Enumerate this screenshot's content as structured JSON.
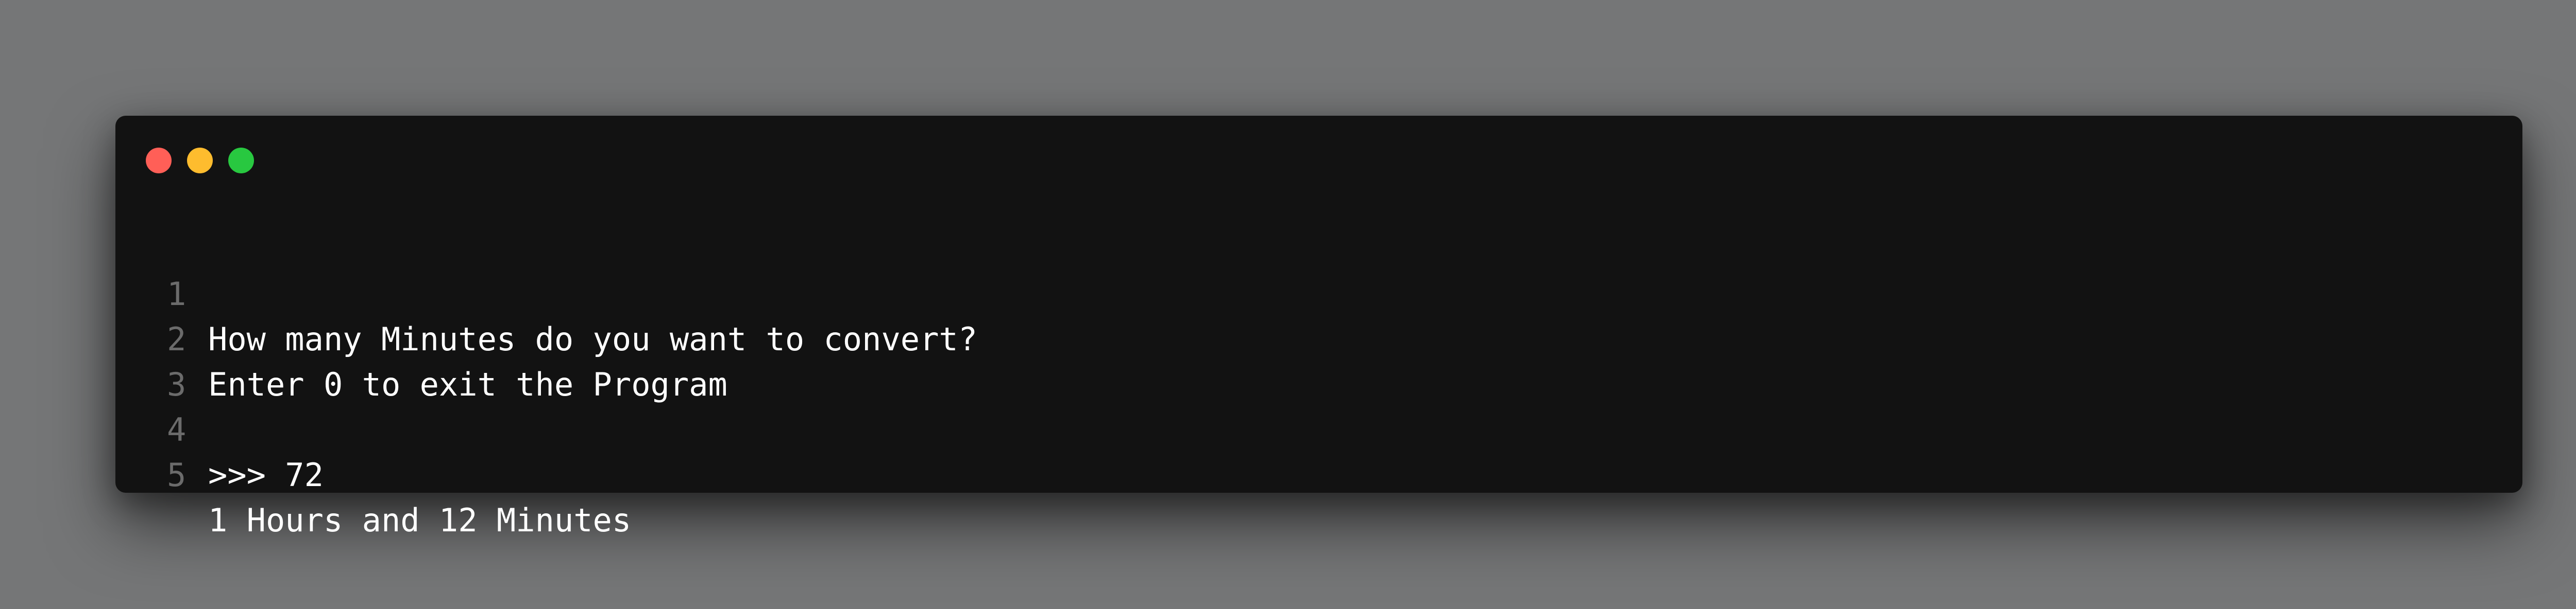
{
  "window": {
    "controls": [
      {
        "name": "close",
        "color": "#ff5f57"
      },
      {
        "name": "minimize",
        "color": "#febc2e"
      },
      {
        "name": "zoom",
        "color": "#28c840"
      }
    ]
  },
  "code": {
    "lines": [
      {
        "number": "1",
        "text": "How many Minutes do you want to convert?"
      },
      {
        "number": "2",
        "text": "Enter 0 to exit the Program"
      },
      {
        "number": "3",
        "text": ""
      },
      {
        "number": "4",
        "text": ">>> 72"
      },
      {
        "number": "5",
        "text": "1 Hours and 12 Minutes"
      }
    ]
  }
}
